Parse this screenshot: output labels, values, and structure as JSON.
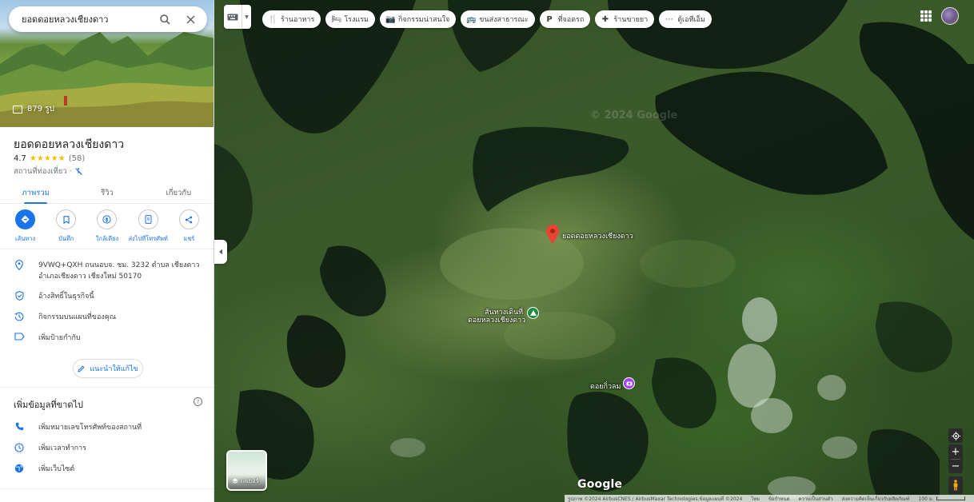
{
  "search": {
    "query": "ยอดดอยหลวงเชียงดาว"
  },
  "hero": {
    "photo_count": "879 รูป"
  },
  "place": {
    "title": "ยอดดอยหลวงเชียงดาว",
    "rating": "4.7",
    "stars": "★★★★★",
    "reviews_count": "(58)",
    "category": "สถานที่ท่องเที่ยว · "
  },
  "tabs": [
    {
      "label": "ภาพรวม",
      "active": true
    },
    {
      "label": "รีวิว",
      "active": false
    },
    {
      "label": "เกี่ยวกับ",
      "active": false
    }
  ],
  "actions": [
    {
      "label": "เส้นทาง",
      "icon": "directions-icon"
    },
    {
      "label": "บันทึก",
      "icon": "bookmark-icon"
    },
    {
      "label": "ใกล้เคียง",
      "icon": "nearby-icon"
    },
    {
      "label": "ส่งไปที่โทรศัพท์",
      "icon": "send-to-phone-icon"
    },
    {
      "label": "แชร์",
      "icon": "share-icon"
    }
  ],
  "details": {
    "address_line1": "9VWQ+QXH ถนนอบจ. ชม. 3232 ตำบล เชียงดาว",
    "address_line2": "อำเภอเชียงดาว เชียงใหม่ 50170",
    "claim": "อ้างสิทธิ์ในธุรกิจนี้",
    "activity": "กิจกรรมบนแผนที่ของคุณ",
    "add_label": "เพิ่มป้ายกำกับ"
  },
  "suggest_edit": "แนะนำให้แก้ไข",
  "missing": {
    "title": "เพิ่มข้อมูลที่ขาดไป",
    "items": [
      {
        "label": "เพิ่มหมายเลขโทรศัพท์ของสถานที่",
        "icon": "phone-icon"
      },
      {
        "label": "เพิ่มเวลาทำการ",
        "icon": "clock-icon"
      },
      {
        "label": "เพิ่มเว็บไซต์",
        "icon": "globe-icon"
      }
    ]
  },
  "chips": [
    {
      "label": "ร้านอาหาร",
      "icon": "restaurant-icon",
      "glyph": "🍴"
    },
    {
      "label": "โรงแรม",
      "icon": "hotel-icon",
      "glyph": "🛏"
    },
    {
      "label": "กิจกรรมน่าสนใจ",
      "icon": "camera-icon",
      "glyph": "📷"
    },
    {
      "label": "ขนส่งสาธารณะ",
      "icon": "transit-icon",
      "glyph": "🚌"
    },
    {
      "label": "ที่จอดรถ",
      "icon": "parking-icon",
      "glyph": "P"
    },
    {
      "label": "ร้านขายยา",
      "icon": "pharmacy-icon",
      "glyph": "✚"
    },
    {
      "label": "ตู้เอทีเอ็ม",
      "icon": "atm-icon",
      "glyph": "⋯"
    }
  ],
  "map": {
    "pin_label": "ยอดดอยหลวงเชียงดาว",
    "camp_label_1": "สันทางเดินที่",
    "camp_label_2": "ดอยหลวงเชียงดาว",
    "peak_label": "ดอยกิ่วลม",
    "watermark": "© 2024 Google"
  },
  "layer_button": {
    "label": "เลเยอร์"
  },
  "google_logo": "Google",
  "footer": {
    "imagery": "รูปภาพ ©2024 AirbusCNES / AirbusMaxar Technologies,ข้อมูลแผนที่ ©2024",
    "thai": "ไทย",
    "terms": "ข้อกำหนด",
    "privacy": "ความเป็นส่วนตัว",
    "feedback": "ส่งความคิดเห็นเกี่ยวกับผลิตภัณฑ์",
    "scale": "100 ม."
  }
}
